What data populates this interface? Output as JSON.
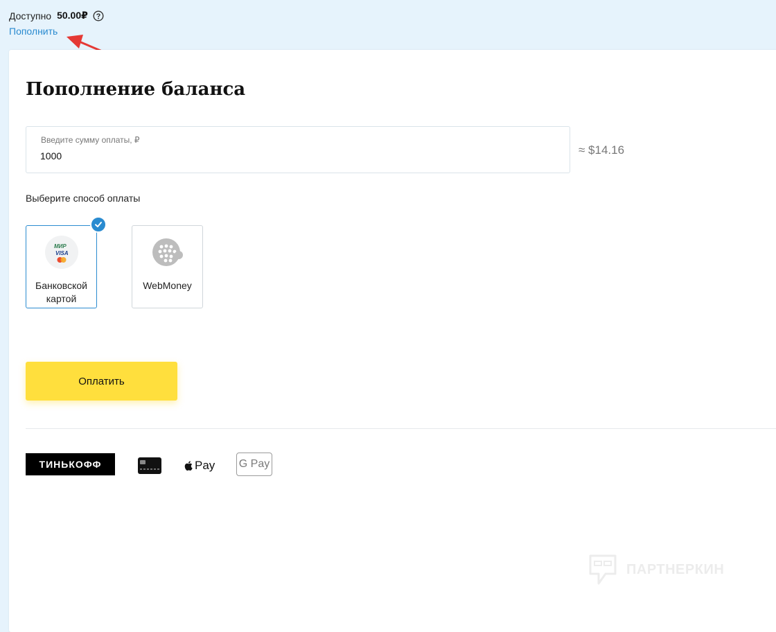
{
  "header": {
    "available_label": "Доступно",
    "balance": "50.00₽",
    "topup_link": "Пополнить"
  },
  "main": {
    "title": "Пополнение баланса",
    "amount_field": {
      "label": "Введите сумму оплаты, ₽",
      "value": "1000"
    },
    "usd_equivalent": "≈ $14.16",
    "method_prompt": "Выберите способ оплаты",
    "methods": [
      {
        "name": "Банковской картой",
        "icon": "mir-visa-mastercard-icon",
        "selected": true
      },
      {
        "name": "WebMoney",
        "icon": "webmoney-icon",
        "selected": false
      }
    ],
    "pay_button": "Оплатить"
  },
  "footer_logos": {
    "tinkoff": "ТИНЬКОФФ",
    "apple_pay": "Pay",
    "google_pay": "G Pay"
  },
  "watermark": "ПАРТНЕРКИН",
  "colors": {
    "accent": "#2a8bd0",
    "pay_button": "#ffdf3d",
    "annotation_arrow": "#e53935",
    "page_bg": "#e6f3fc"
  }
}
